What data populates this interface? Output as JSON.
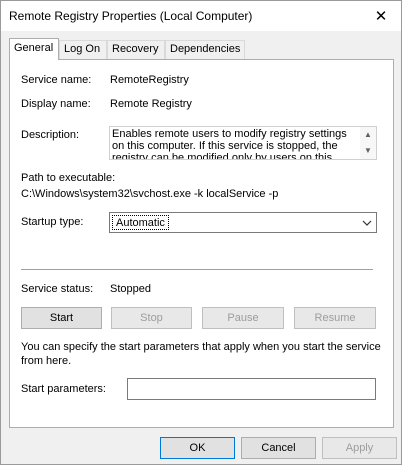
{
  "window": {
    "title": "Remote Registry Properties (Local Computer)",
    "close_glyph": "✕"
  },
  "tabs": [
    {
      "label": "General",
      "active": true
    },
    {
      "label": "Log On",
      "active": false
    },
    {
      "label": "Recovery",
      "active": false
    },
    {
      "label": "Dependencies",
      "active": false
    }
  ],
  "general": {
    "service_name_label": "Service name:",
    "service_name_value": "RemoteRegistry",
    "display_name_label": "Display name:",
    "display_name_value": "Remote Registry",
    "description_label": "Description:",
    "description_value": "Enables remote users to modify registry settings on this computer. If this service is stopped, the registry can be modified only by users on this computer. If",
    "path_label": "Path to executable:",
    "path_value": "C:\\Windows\\system32\\svchost.exe -k localService -p",
    "startup_type_label": "Startup type:",
    "startup_type_value": "Automatic",
    "service_status_label": "Service status:",
    "service_status_value": "Stopped",
    "buttons": {
      "start": "Start",
      "stop": "Stop",
      "pause": "Pause",
      "resume": "Resume"
    },
    "start_params_help": "You can specify the start parameters that apply when you start the service from here.",
    "start_params_label": "Start parameters:",
    "start_params_value": ""
  },
  "footer": {
    "ok": "OK",
    "cancel": "Cancel",
    "apply": "Apply"
  }
}
